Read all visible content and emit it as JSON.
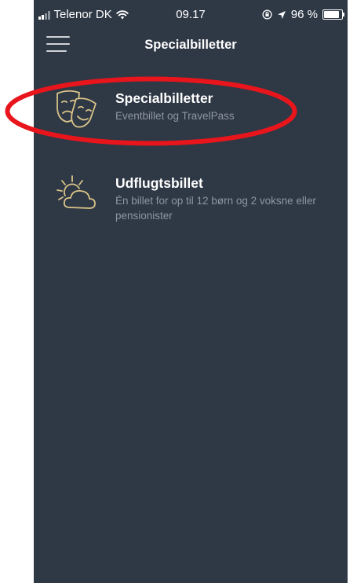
{
  "status_bar": {
    "carrier": "Telenor DK",
    "time": "09.17",
    "battery": "96 %",
    "battery_level": 0.96
  },
  "header": {
    "title": "Specialbilletter"
  },
  "items": [
    {
      "title": "Specialbilletter",
      "subtitle": "Eventbillet og TravelPass",
      "icon": "theater-masks-icon"
    },
    {
      "title": "Udflugtsbillet",
      "subtitle": "Én billet for op til 12 børn og 2 voksne eller pensionister",
      "icon": "sun-cloud-icon"
    }
  ],
  "colors": {
    "background": "#2f3845",
    "icon_gold": "#d9c489",
    "highlight": "#e8151c",
    "subtitle": "#8d96a2"
  }
}
